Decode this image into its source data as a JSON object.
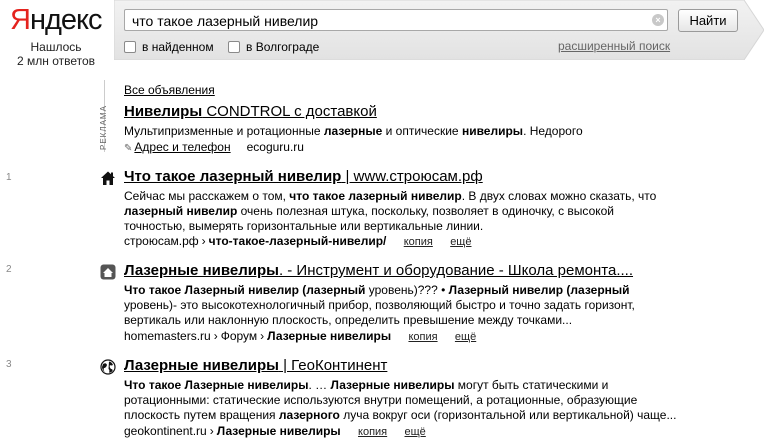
{
  "header": {
    "logo_first": "Я",
    "logo_rest": "ндекс",
    "found_line1": "Нашлось",
    "found_line2": "2 млн ответов"
  },
  "search": {
    "query": "что такое лазерный нивелир",
    "button_label": "Найти",
    "option_in_found": "в найденном",
    "option_region": "в Волгограде",
    "advanced_link": "расширенный поиск"
  },
  "ad": {
    "side_label": "РЕКЛАМА",
    "all_ads": "Все объявления",
    "title_bold": "Нивелиры",
    "title_rest": " CONDTROL с доставкой",
    "snippet": [
      "Мультипризменные и ротационные ",
      "лазерные",
      " и оптические ",
      "нивелиры",
      ". Недорого"
    ],
    "contacts_link": "Адрес и телефон",
    "domain": "ecoguru.ru"
  },
  "results": [
    {
      "num": "1",
      "title_bold": "Что такое лазерный нивелир",
      "title_rest": " | www.строюсам.рф",
      "snippet": [
        [
          "Сейчас мы расскажем о том, ",
          "что такое лазерный нивелир",
          ". В двух словах можно сказать, что"
        ],
        [
          "",
          "лазерный нивелир",
          " очень полезная штука, поскольку, позволяет в одиночку, с высокой"
        ],
        [
          "точностью, вымерять горизонтальные или вертикальные линии.",
          "",
          ""
        ]
      ],
      "url_host": "строюсам.рф",
      "url_path": "что-такое-лазерный-нивелир/",
      "copy_link": "копия",
      "more_link": "ещё"
    },
    {
      "num": "2",
      "title_bold": "Лазерные нивелиры",
      "title_rest": ". - Инструмент и оборудование - Школа ремонта....",
      "snippet": [
        [
          "",
          "Что такое Лазерный нивелир (лазерный",
          " уровень)??? • ",
          "Лазерный нивелир (лазерный",
          ""
        ],
        [
          "уровень)- это высокотехнологичный прибор, позволяющий быстро и точно задать горизонт,",
          "",
          "",
          "",
          ""
        ],
        [
          "вертикаль или наклонную плоскость, определить превышение между точками...",
          "",
          "",
          "",
          ""
        ]
      ],
      "url_host": "homemasters.ru",
      "url_mid": "Форум",
      "url_path": "Лазерные нивелиры",
      "copy_link": "копия",
      "more_link": "ещё"
    },
    {
      "num": "3",
      "title_bold": "Лазерные нивелиры",
      "title_rest": " | ГеоКонтинент",
      "snippet": [
        [
          "",
          "Что такое Лазерные нивелиры",
          ". … ",
          "Лазерные нивелиры",
          " могут быть статическими и"
        ],
        [
          "ротационными: статические используются внутри помещений, а ротационные, образующие",
          "",
          "",
          "",
          ""
        ],
        [
          "плоскость путем вращения ",
          "лазерного",
          " луча вокруг оси (горизонтальной или вертикальной) чаще...",
          "",
          ""
        ]
      ],
      "url_host": "geokontinent.ru",
      "url_path": "Лазерные нивелиры",
      "copy_link": "копия",
      "more_link": "ещё"
    }
  ],
  "colors": {
    "logo_red": "#e4231e",
    "header_bar": "#ebebeb"
  },
  "icons": {
    "result_1": "house-icon",
    "result_2": "site-favicon",
    "result_3": "globe-icon",
    "contacts": "pin-icon"
  }
}
